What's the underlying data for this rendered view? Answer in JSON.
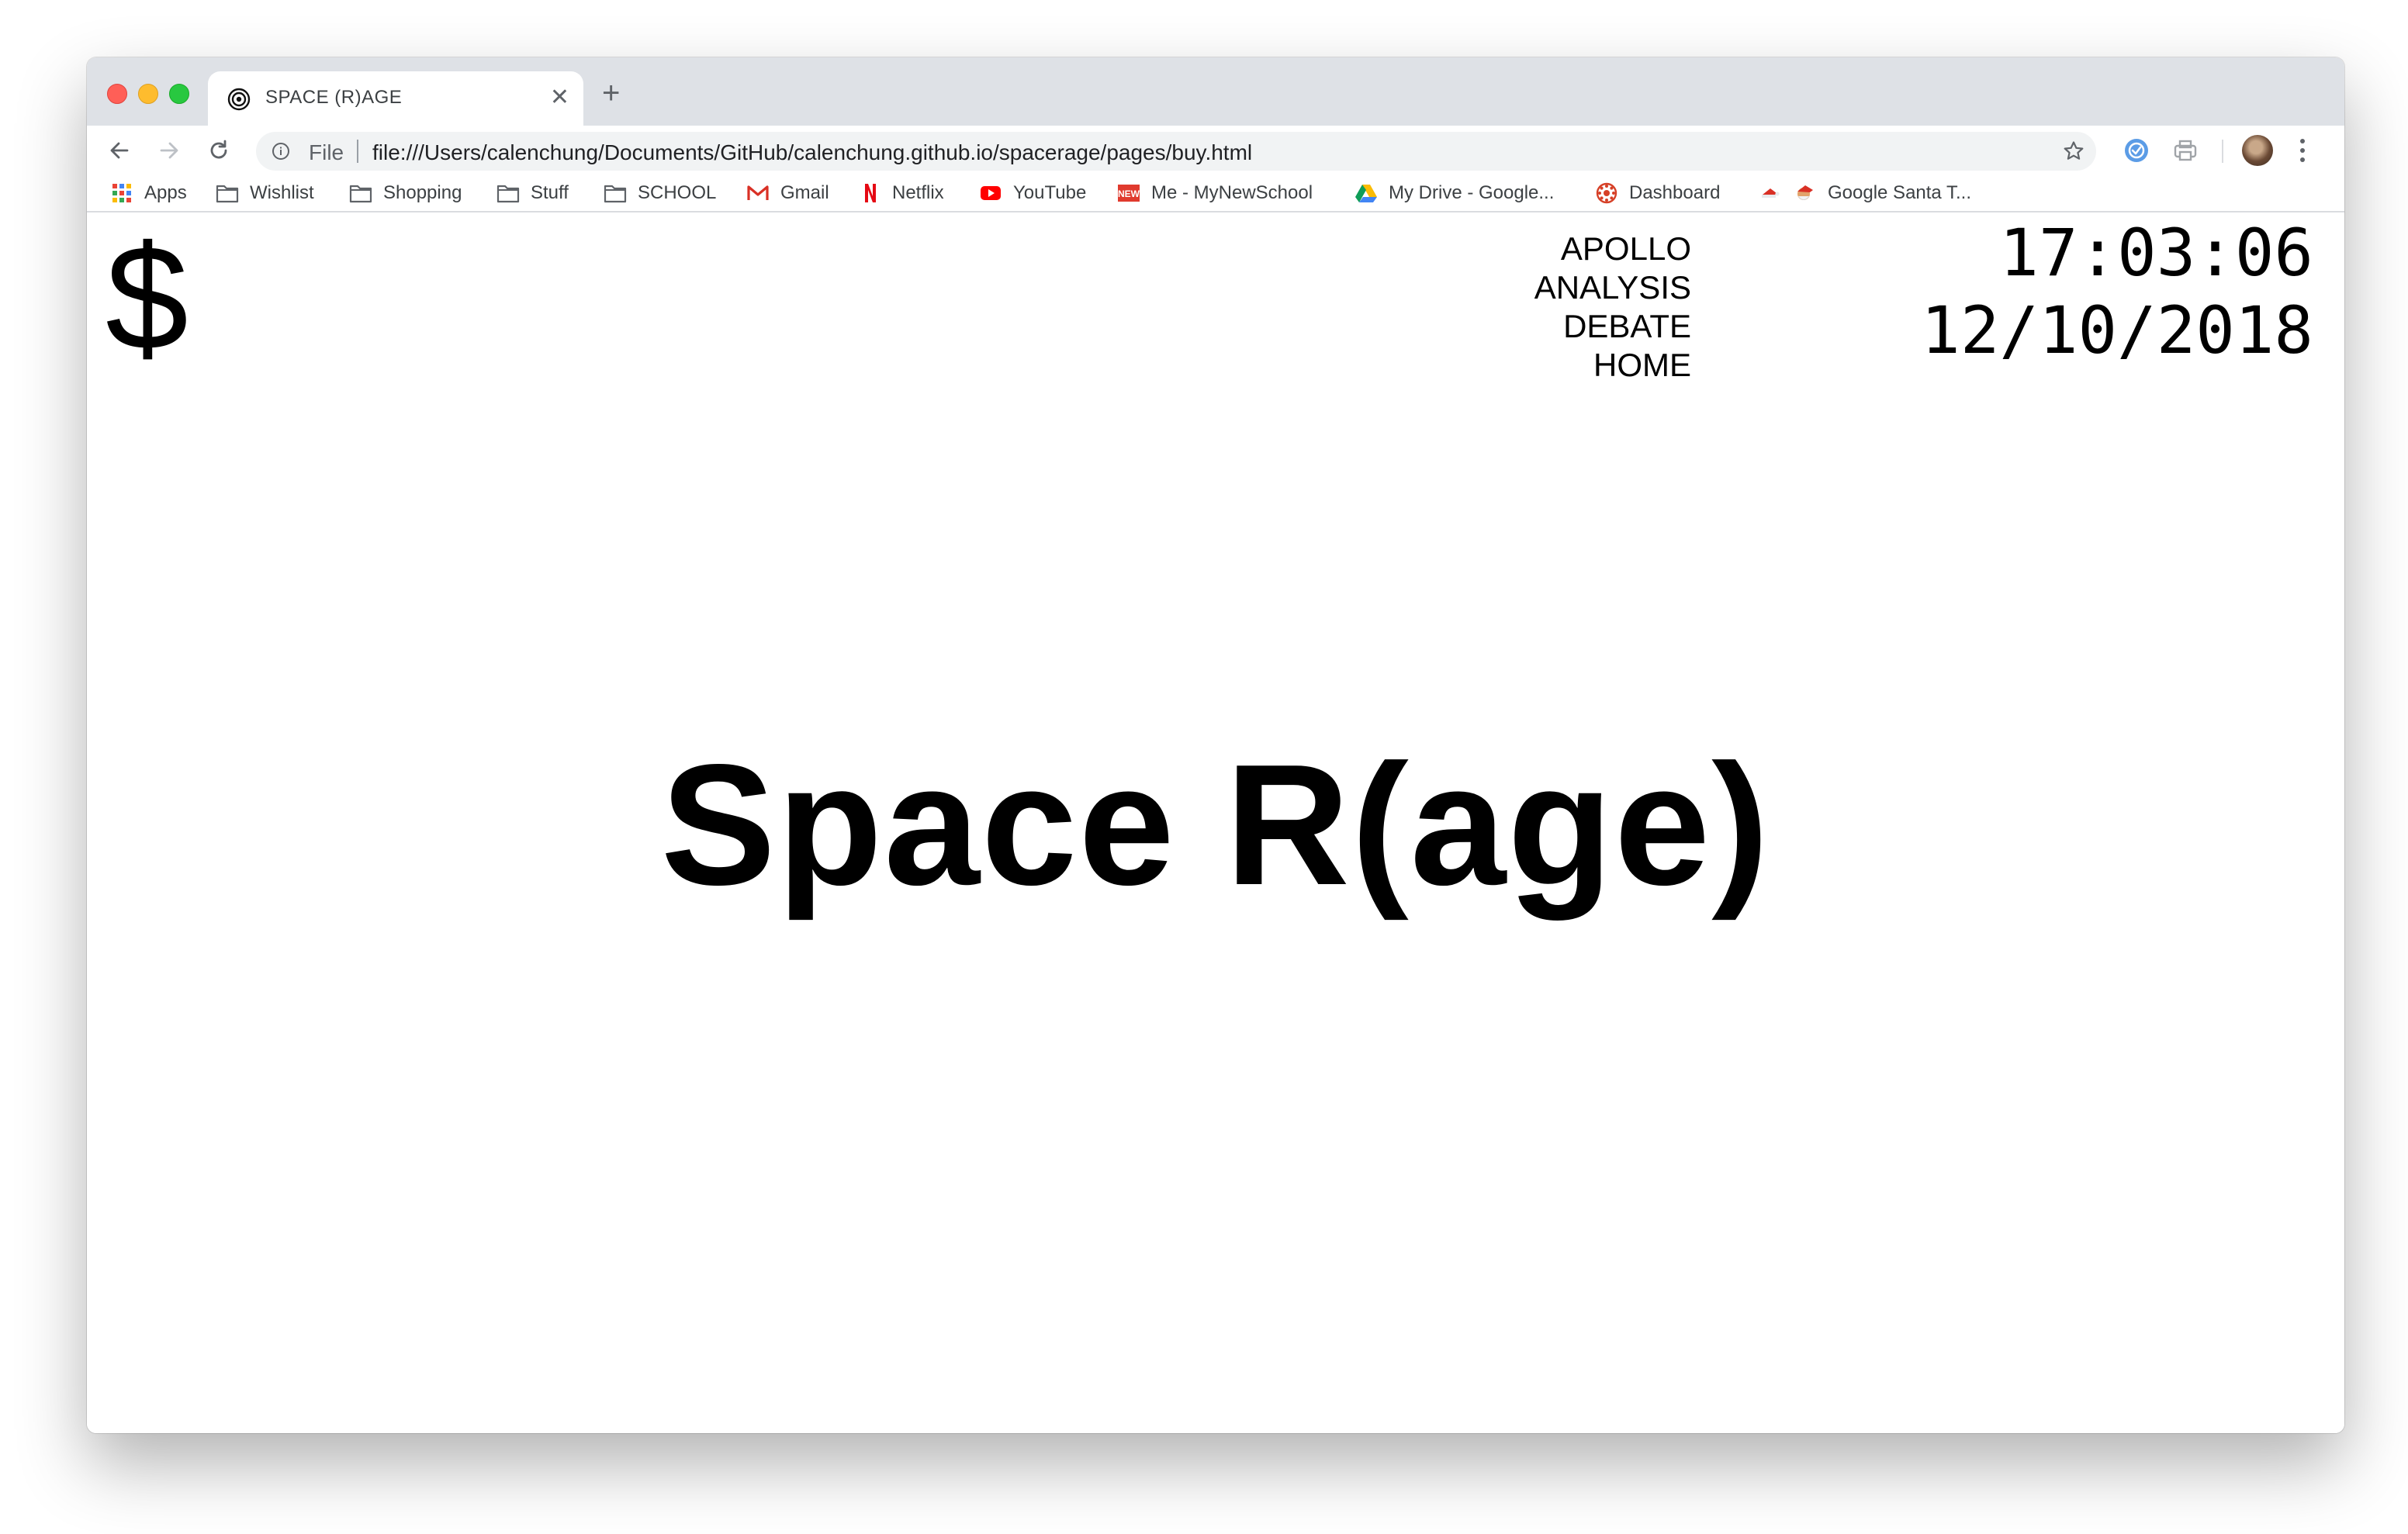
{
  "browser": {
    "tab": {
      "title": "SPACE (R)AGE",
      "icon": "target-icon",
      "close_glyph": "✕"
    },
    "new_tab_glyph": "+",
    "omnibox": {
      "scheme_label": "File",
      "url": "file:///Users/calenchung/Documents/GitHub/calenchung.github.io/spacerage/pages/buy.html"
    },
    "bookmarks": [
      {
        "label": "Apps",
        "icon": "apps-grid-icon"
      },
      {
        "label": "Wishlist",
        "icon": "folder-icon"
      },
      {
        "label": "Shopping",
        "icon": "folder-icon"
      },
      {
        "label": "Stuff",
        "icon": "folder-icon"
      },
      {
        "label": "SCHOOL",
        "icon": "folder-icon"
      },
      {
        "label": "Gmail",
        "icon": "gmail-icon"
      },
      {
        "label": "Netflix",
        "icon": "netflix-icon"
      },
      {
        "label": "YouTube",
        "icon": "youtube-icon"
      },
      {
        "label": "Me - MyNewSchool",
        "icon": "new-icon"
      },
      {
        "label": "My Drive - Google...",
        "icon": "drive-icon"
      },
      {
        "label": "Dashboard",
        "icon": "dashboard-icon"
      },
      {
        "label": "",
        "icon": "santa-hat-icon"
      },
      {
        "label": "Google Santa T...",
        "icon": "santa-icon"
      }
    ]
  },
  "page": {
    "logo": "$",
    "nav": [
      "APOLLO",
      "ANALYSIS",
      "DEBATE",
      "HOME"
    ],
    "clock": {
      "time": "17:03:06",
      "date": "12/10/2018"
    },
    "hero_title": "Space R(age)"
  },
  "colors": {
    "tabstrip_bg": "#dee1e6",
    "omnibox_bg": "#f1f3f4",
    "page_bg": "#ffffff",
    "text": "#000000"
  }
}
